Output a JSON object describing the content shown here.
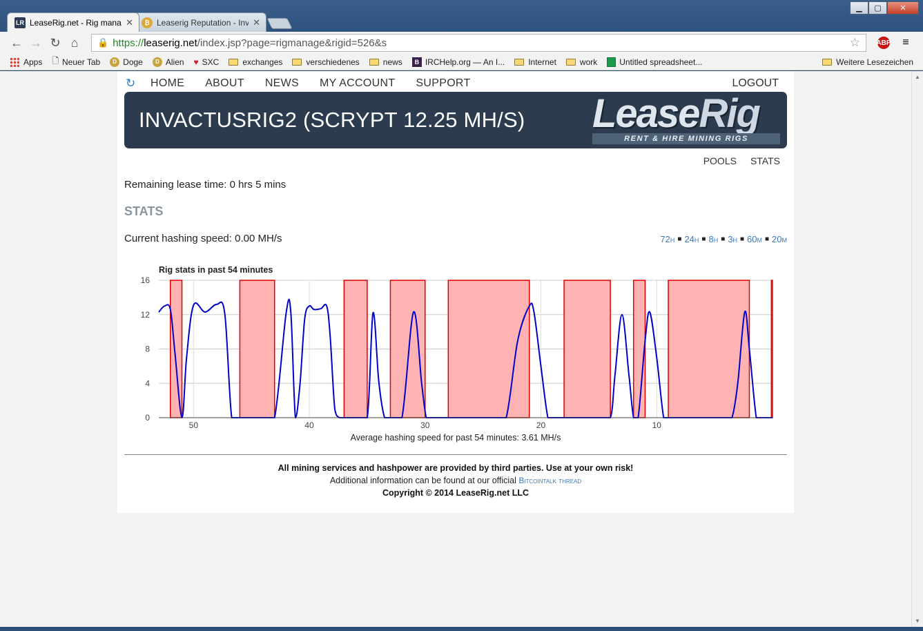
{
  "browser": {
    "tabs": [
      {
        "label": "LeaseRig.net - Rig manage",
        "favicon": "LR"
      },
      {
        "label": "Leaserig Reputation - Inva",
        "favicon": "coin"
      }
    ],
    "url": {
      "scheme": "https://",
      "host": "leaserig.net",
      "path": "/index.jsp?page=rigmanage&rigid=526&s"
    },
    "bookmarks": [
      {
        "label": "Apps",
        "icon": "apps-grid-icon"
      },
      {
        "label": "Neuer Tab",
        "icon": "page-icon"
      },
      {
        "label": "Doge",
        "icon": "doge-coin-icon"
      },
      {
        "label": "Alien",
        "icon": "doge-coin-icon"
      },
      {
        "label": "SXC",
        "icon": "heart-icon"
      },
      {
        "label": "exchanges",
        "icon": "folder-icon"
      },
      {
        "label": "verschiedenes",
        "icon": "folder-icon"
      },
      {
        "label": "news",
        "icon": "folder-icon"
      },
      {
        "label": "IRCHelp.org — An I...",
        "icon": "b-icon"
      },
      {
        "label": "Internet",
        "icon": "folder-icon"
      },
      {
        "label": "work",
        "icon": "folder-icon"
      },
      {
        "label": "Untitled spreadsheet...",
        "icon": "sheets-icon"
      }
    ],
    "other_bookmarks": "Weitere Lesezeichen"
  },
  "nav": {
    "items": [
      "HOME",
      "ABOUT",
      "NEWS",
      "MY ACCOUNT",
      "SUPPORT"
    ],
    "logout": "LOGOUT"
  },
  "banner": {
    "title": "INVACTUSRIG2 (SCRYPT 12.25 MH/S)",
    "logo_word_a": "Lease",
    "logo_word_b": "Rig",
    "logo_tagline": "RENT & HIRE MINING RIGS"
  },
  "subnav": [
    "POOLS",
    "STATS"
  ],
  "lease_time": "Remaining lease time: 0 hrs 5 mins",
  "stats_heading": "STATS",
  "current_speed": "Current hashing speed: 0.00 MH/s",
  "ranges": [
    {
      "num": "72",
      "unit": "h"
    },
    {
      "num": "24",
      "unit": "h"
    },
    {
      "num": "8",
      "unit": "h"
    },
    {
      "num": "3",
      "unit": "h"
    },
    {
      "num": "60",
      "unit": "m"
    },
    {
      "num": "20",
      "unit": "m"
    }
  ],
  "chart_data": {
    "type": "line",
    "title": "Rig stats in past 54 minutes",
    "xlabel": "Average hashing speed for past 54 minutes: 3.61 MH/s",
    "ylabel": "",
    "xlim": [
      53,
      0
    ],
    "ylim": [
      0,
      16
    ],
    "x_ticks": [
      50,
      40,
      30,
      20,
      10
    ],
    "y_ticks": [
      0,
      4,
      8,
      12,
      16
    ],
    "grid": true,
    "series": [
      {
        "color": "#0000cc",
        "x": [
          53,
          52.5,
          52,
          51.6,
          51.0,
          50.6,
          50.0,
          49.0,
          48.0,
          47.3,
          46.7,
          46.0,
          45.0,
          44.0,
          43.0,
          42.0,
          41.6,
          41.2,
          40.8,
          40.4,
          40.0,
          39.6,
          39.0,
          38.5,
          38.2,
          37.8,
          37.4,
          37.0,
          36.0,
          35.0,
          34.5,
          34.0,
          33.5,
          33.0,
          32.0,
          31.0,
          30.3,
          29.9,
          29.5,
          29.0,
          28.0,
          27.0,
          26.0,
          25.0,
          24.0,
          23.0,
          22.0,
          21.0,
          20.6,
          20.0,
          19.4,
          19.0,
          18.0,
          17.0,
          16.0,
          15.0,
          14.0,
          13.6,
          13.0,
          12.4,
          12.0,
          11.6,
          11.0,
          10.6,
          10.0,
          9.4,
          9.0,
          8.0,
          7.0,
          6.0,
          5.0,
          4.0,
          3.5,
          3.0,
          2.4,
          2.0,
          1.4,
          1.0,
          0.5,
          0
        ],
        "values": [
          12.3,
          13.0,
          12.6,
          7.5,
          0,
          7,
          13.1,
          12.3,
          13.2,
          12.1,
          0,
          0,
          0,
          0,
          0,
          12.2,
          12.3,
          0,
          4,
          11.5,
          13.0,
          12.6,
          12.7,
          13.0,
          9.5,
          1,
          0,
          0,
          0,
          0,
          12.2,
          4.2,
          0,
          0,
          0,
          12.3,
          4,
          0,
          0,
          0,
          0,
          0,
          0,
          0,
          0,
          0,
          9,
          13.0,
          12.3,
          6,
          0,
          0,
          0,
          0,
          0,
          0,
          0,
          5,
          12.0,
          5,
          0,
          0,
          9,
          12.3,
          7,
          0,
          0,
          0,
          0,
          0,
          0,
          0,
          0,
          4,
          12.3,
          8,
          0,
          0,
          0,
          0
        ]
      }
    ],
    "bands": [
      [
        52.0,
        51.0
      ],
      [
        46.0,
        43.0
      ],
      [
        41.0,
        41.0
      ],
      [
        37.0,
        35.0
      ],
      [
        33.0,
        30.0
      ],
      [
        28.0,
        21.0
      ],
      [
        18.0,
        14.0
      ],
      [
        12.0,
        11.0
      ],
      [
        9.0,
        2.0
      ],
      [
        0.1,
        0
      ]
    ],
    "band_color": "#ffb3b3",
    "band_edge_color": "#dd0000"
  },
  "footer": {
    "line1": "All mining services and hashpower are provided by third parties. Use at your own risk!",
    "line2_prefix": "Additional information can be found at our official",
    "line2_link": "Bitcointalk thread",
    "line3": "Copyright © 2014 LeaseRig.net LLC"
  }
}
